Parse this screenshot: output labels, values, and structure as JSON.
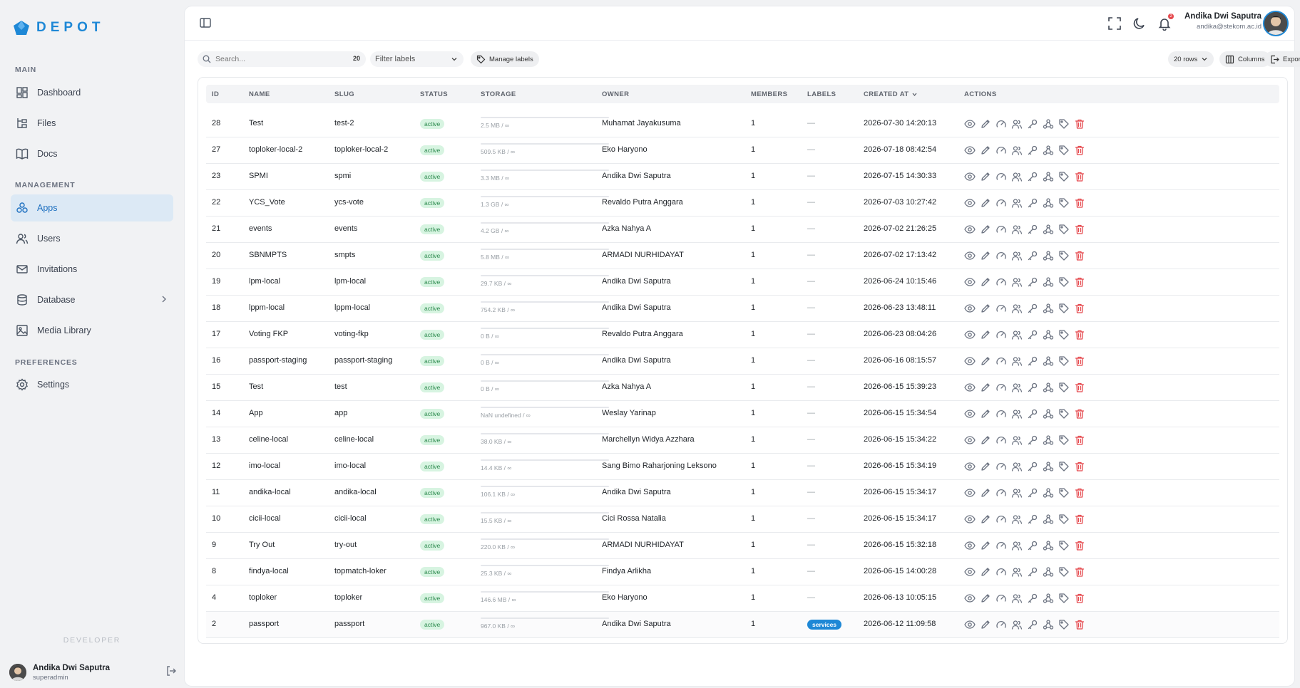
{
  "brand": {
    "name": "DEPOT"
  },
  "sidebar": {
    "sections": [
      {
        "label": "MAIN"
      },
      {
        "label": "MANAGEMENT"
      },
      {
        "label": "PREFERENCES"
      }
    ],
    "items": [
      {
        "label": "Dashboard",
        "icon": "dashboard-icon"
      },
      {
        "label": "Files",
        "icon": "files-icon"
      },
      {
        "label": "Docs",
        "icon": "docs-icon"
      },
      {
        "label": "Apps",
        "icon": "apps-icon",
        "active": true
      },
      {
        "label": "Users",
        "icon": "users-icon"
      },
      {
        "label": "Invitations",
        "icon": "mail-icon"
      },
      {
        "label": "Database",
        "icon": "database-icon"
      },
      {
        "label": "Media Library",
        "icon": "image-icon"
      },
      {
        "label": "Settings",
        "icon": "gear-icon"
      }
    ],
    "developer_label": "DEVELOPER",
    "user": {
      "name": "Andika Dwi Saputra",
      "role": "superadmin"
    }
  },
  "header": {
    "user_name": "Andika Dwi Saputra",
    "user_email": "andika@stekom.ac.id",
    "notification_count": "2"
  },
  "toolbar": {
    "search_placeholder": "Search...",
    "search_count": "20",
    "filter_placeholder": "Filter labels",
    "manage_labels": "Manage labels",
    "rows": "20 rows",
    "columns": "Columns",
    "export": "Export"
  },
  "table": {
    "headers": {
      "id": "ID",
      "name": "NAME",
      "slug": "SLUG",
      "status": "STATUS",
      "storage": "STORAGE",
      "owner": "OWNER",
      "members": "MEMBERS",
      "labels": "LABELS",
      "created_at": "CREATED AT",
      "actions": "ACTIONS"
    },
    "rows": [
      {
        "id": "28",
        "name": "Test",
        "slug": "test-2",
        "status": "active",
        "storage": "2.5 MB / ∞",
        "owner": "Muhamat Jayakusuma",
        "members": "1",
        "labels": "—",
        "created_at": "2026-07-30 14:20:13"
      },
      {
        "id": "27",
        "name": "toploker-local-2",
        "slug": "toploker-local-2",
        "status": "active",
        "storage": "509.5 KB / ∞",
        "owner": "Eko Haryono",
        "members": "1",
        "labels": "—",
        "created_at": "2026-07-18 08:42:54"
      },
      {
        "id": "23",
        "name": "SPMI",
        "slug": "spmi",
        "status": "active",
        "storage": "3.3 MB / ∞",
        "owner": "Andika Dwi Saputra",
        "members": "1",
        "labels": "—",
        "created_at": "2026-07-15 14:30:33"
      },
      {
        "id": "22",
        "name": "YCS_Vote",
        "slug": "ycs-vote",
        "status": "active",
        "storage": "1.3 GB / ∞",
        "owner": "Revaldo Putra Anggara",
        "members": "1",
        "labels": "—",
        "created_at": "2026-07-03 10:27:42"
      },
      {
        "id": "21",
        "name": "events",
        "slug": "events",
        "status": "active",
        "storage": "4.2 GB / ∞",
        "owner": "Azka Nahya A",
        "members": "1",
        "labels": "—",
        "created_at": "2026-07-02 21:26:25"
      },
      {
        "id": "20",
        "name": "SBNMPTS",
        "slug": "smpts",
        "status": "active",
        "storage": "5.8 MB / ∞",
        "owner": "ARMADI NURHIDAYAT",
        "members": "1",
        "labels": "—",
        "created_at": "2026-07-02 17:13:42"
      },
      {
        "id": "19",
        "name": "lpm-local",
        "slug": "lpm-local",
        "status": "active",
        "storage": "29.7 KB / ∞",
        "owner": "Andika Dwi Saputra",
        "members": "1",
        "labels": "—",
        "created_at": "2026-06-24 10:15:46"
      },
      {
        "id": "18",
        "name": "lppm-local",
        "slug": "lppm-local",
        "status": "active",
        "storage": "754.2 KB / ∞",
        "owner": "Andika Dwi Saputra",
        "members": "1",
        "labels": "—",
        "created_at": "2026-06-23 13:48:11"
      },
      {
        "id": "17",
        "name": "Voting FKP",
        "slug": "voting-fkp",
        "status": "active",
        "storage": "0 B / ∞",
        "owner": "Revaldo Putra Anggara",
        "members": "1",
        "labels": "—",
        "created_at": "2026-06-23 08:04:26"
      },
      {
        "id": "16",
        "name": "passport-staging",
        "slug": "passport-staging",
        "status": "active",
        "storage": "0 B / ∞",
        "owner": "Andika Dwi Saputra",
        "members": "1",
        "labels": "—",
        "created_at": "2026-06-16 08:15:57"
      },
      {
        "id": "15",
        "name": "Test",
        "slug": "test",
        "status": "active",
        "storage": "0 B / ∞",
        "owner": "Azka Nahya A",
        "members": "1",
        "labels": "—",
        "created_at": "2026-06-15 15:39:23"
      },
      {
        "id": "14",
        "name": "App",
        "slug": "app",
        "status": "active",
        "storage": "NaN undefined / ∞",
        "owner": "Weslay Yarinap",
        "members": "1",
        "labels": "—",
        "created_at": "2026-06-15 15:34:54"
      },
      {
        "id": "13",
        "name": "celine-local",
        "slug": "celine-local",
        "status": "active",
        "storage": "38.0 KB / ∞",
        "owner": "Marchellyn Widya Azzhara",
        "members": "1",
        "labels": "—",
        "created_at": "2026-06-15 15:34:22"
      },
      {
        "id": "12",
        "name": "imo-local",
        "slug": "imo-local",
        "status": "active",
        "storage": "14.4 KB / ∞",
        "owner": "Sang Bimo Raharjoning Leksono",
        "members": "1",
        "labels": "—",
        "created_at": "2026-06-15 15:34:19"
      },
      {
        "id": "11",
        "name": "andika-local",
        "slug": "andika-local",
        "status": "active",
        "storage": "106.1 KB / ∞",
        "owner": "Andika Dwi Saputra",
        "members": "1",
        "labels": "—",
        "created_at": "2026-06-15 15:34:17"
      },
      {
        "id": "10",
        "name": "cicii-local",
        "slug": "cicii-local",
        "status": "active",
        "storage": "15.5 KB / ∞",
        "owner": "Cici Rossa Natalia",
        "members": "1",
        "labels": "—",
        "created_at": "2026-06-15 15:34:17"
      },
      {
        "id": "9",
        "name": "Try Out",
        "slug": "try-out",
        "status": "active",
        "storage": "220.0 KB / ∞",
        "owner": "ARMADI NURHIDAYAT",
        "members": "1",
        "labels": "—",
        "created_at": "2026-06-15 15:32:18"
      },
      {
        "id": "8",
        "name": "findya-local",
        "slug": "topmatch-loker",
        "status": "active",
        "storage": "25.3 KB / ∞",
        "owner": "Findya Arlikha",
        "members": "1",
        "labels": "—",
        "created_at": "2026-06-15 14:00:28"
      },
      {
        "id": "4",
        "name": "toploker",
        "slug": "toploker",
        "status": "active",
        "storage": "146.6 MB / ∞",
        "owner": "Eko Haryono",
        "members": "1",
        "labels": "—",
        "created_at": "2026-06-13 10:05:15"
      },
      {
        "id": "2",
        "name": "passport",
        "slug": "passport",
        "status": "active",
        "storage": "967.0 KB / ∞",
        "owner": "Andika Dwi Saputra",
        "members": "1",
        "labels": "services",
        "created_at": "2026-06-12 11:09:58"
      }
    ],
    "row_actions": [
      "eye-icon",
      "edit-icon",
      "gauge-icon",
      "users-icon",
      "key-icon",
      "webhook-icon",
      "tag-icon",
      "trash-icon"
    ]
  },
  "colors": {
    "accent": "#1e88d6",
    "danger": "#e5484d",
    "active_badge_bg": "#d7f4e1",
    "active_badge_fg": "#2d8a4e"
  }
}
